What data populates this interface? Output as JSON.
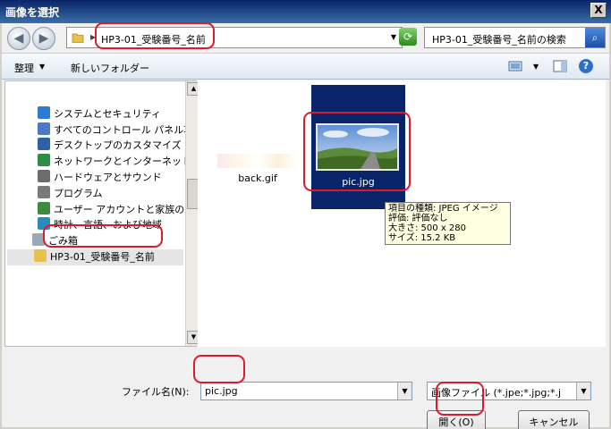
{
  "window": {
    "title": "画像を選択",
    "close_glyph": "X"
  },
  "address": {
    "path": "HP3-01_受験番号_名前",
    "separator": "▶",
    "dropdown": "▼"
  },
  "search": {
    "placeholder": "HP3-01_受験番号_名前の検索"
  },
  "toolbar": {
    "organize": "整理",
    "organize_arrow": "▼",
    "new_folder": "新しいフォルダー",
    "view_arrow": "▼",
    "help": "?"
  },
  "nav": {
    "items": [
      {
        "label": "システムとセキュリティ",
        "icon": "shield-icon",
        "color": "#2f7bd1"
      },
      {
        "label": "すべてのコントロール パネル項",
        "icon": "control-panel-icon",
        "color": "#4b7bc4"
      },
      {
        "label": "デスクトップのカスタマイズ",
        "icon": "desktop-icon",
        "color": "#3060a8"
      },
      {
        "label": "ネットワークとインターネット",
        "icon": "network-icon",
        "color": "#2c8c4a"
      },
      {
        "label": "ハードウェアとサウンド",
        "icon": "printer-icon",
        "color": "#6c6c6c"
      },
      {
        "label": "プログラム",
        "icon": "program-icon",
        "color": "#7a7a7a"
      },
      {
        "label": "ユーザー アカウントと家族のた",
        "icon": "users-icon",
        "color": "#3f8a3f"
      },
      {
        "label": "時計、言語、および地域",
        "icon": "clock-icon",
        "color": "#2a8bbd"
      },
      {
        "label": "ごみ箱",
        "icon": "recycle-bin-icon",
        "color": "#9aa9b8"
      },
      {
        "label": "HP3-01_受験番号_名前",
        "icon": "folder-icon",
        "color": "#e8c14a"
      }
    ]
  },
  "files": [
    {
      "name": "back.gif",
      "selected": false
    },
    {
      "name": "pic.jpg",
      "selected": true
    }
  ],
  "tooltip": {
    "type": "項目の種類: JPEG イメージ",
    "rating": "評価: 評価なし",
    "size_dims": "大きさ: 500 x 280",
    "size": "サイズ: 15.2 KB"
  },
  "bottom": {
    "filename_label": "ファイル名(N):",
    "filename_value": "pic.jpg",
    "filetype_value": "画像ファイル (*.jpe;*.jpg;*.j",
    "open_button": "開く(O)",
    "cancel_button": "キャンセル"
  },
  "colors": {
    "highlight": "#e0192a",
    "selection": "#0a246a"
  }
}
